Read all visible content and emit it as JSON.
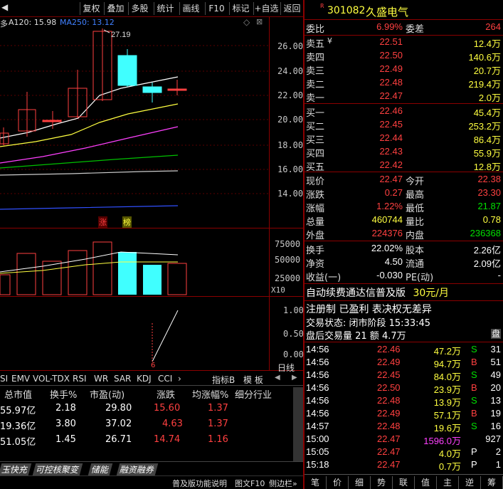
{
  "toolbar": {
    "back_arrow": "◀",
    "buttons": [
      "复权",
      "叠加",
      "多股",
      "统计",
      "画线",
      "F10",
      "标记",
      "+自选",
      "返回"
    ]
  },
  "chart_header": {
    "left_text": "多",
    "ma_text": "A120: 15.98",
    "ma250_text": "MA250: 13.12",
    "high_marker": "27.19"
  },
  "price_axis": [
    "26.00",
    "24.00",
    "22.00",
    "20.00",
    "18.00",
    "16.00",
    "14.00"
  ],
  "badges": {
    "zhang": "涨",
    "bang": "榜"
  },
  "volume_axis": [
    "75000",
    "50000",
    "25000",
    "X10"
  ],
  "indicator_axis": [
    "1.00",
    "0.50",
    "0.00"
  ],
  "indicator_date": "6",
  "sidebar_label": "日线",
  "indicator_tabs": [
    "SI",
    "EMV",
    "VOL-TDX",
    "RSI",
    "WR",
    "SAR",
    "KDJ",
    "CCI",
    "›"
  ],
  "indicator_extra": [
    "指标B",
    "模 板",
    "◀",
    "▶"
  ],
  "table": {
    "headers": [
      "总市值",
      "换手%",
      "市盈(动)",
      "涨跌",
      "均涨幅%",
      "细分行业"
    ],
    "rows": [
      [
        "55.97亿",
        "2.18",
        "29.80",
        "15.60",
        "1.37"
      ],
      [
        "19.36亿",
        "3.80",
        "37.02",
        "4.63",
        "1.37"
      ],
      [
        "51.05亿",
        "1.45",
        "26.71",
        "14.74",
        "1.16"
      ]
    ]
  },
  "bottom_tabs": [
    "玉快充",
    "可控核聚变",
    "储能",
    "融资融券"
  ],
  "bottom_right": [
    "普及版功能说明",
    "图文F10",
    "侧边栏»"
  ],
  "stock": {
    "code": "301082",
    "name": "久盛电气",
    "flag": "R"
  },
  "weibi": {
    "label1": "委比",
    "val1": "6.99%",
    "label2": "委差",
    "val2": "264"
  },
  "sells": [
    {
      "label": "卖五",
      "mark": "¥",
      "price": "22.51",
      "vol": "12.4万"
    },
    {
      "label": "卖四",
      "mark": "",
      "price": "22.50",
      "vol": "140.6万"
    },
    {
      "label": "卖三",
      "mark": "",
      "price": "22.49",
      "vol": "20.7万"
    },
    {
      "label": "卖二",
      "mark": "",
      "price": "22.48",
      "vol": "219.4万"
    },
    {
      "label": "卖一",
      "mark": "",
      "price": "22.47",
      "vol": "2.0万"
    }
  ],
  "buys": [
    {
      "label": "买一",
      "price": "22.46",
      "vol": "45.4万"
    },
    {
      "label": "买二",
      "price": "22.45",
      "vol": "253.2万"
    },
    {
      "label": "买三",
      "price": "22.44",
      "vol": "86.4万"
    },
    {
      "label": "买四",
      "price": "22.43",
      "vol": "55.9万"
    },
    {
      "label": "买五",
      "price": "22.42",
      "vol": "12.8万"
    }
  ],
  "stats1": [
    {
      "l1": "现价",
      "v1": "22.47",
      "l2": "今开",
      "v2": "22.38"
    },
    {
      "l1": "涨跌",
      "v1": "0.27",
      "l2": "最高",
      "v2": "23.30"
    },
    {
      "l1": "涨幅",
      "v1": "1.22%",
      "l2": "最低",
      "v2": "21.87"
    },
    {
      "l1": "总量",
      "v1": "460744",
      "l2": "量比",
      "v2": "0.78"
    },
    {
      "l1": "外盘",
      "v1": "224376",
      "l2": "内盘",
      "v2": "236368"
    }
  ],
  "stats2": [
    {
      "l1": "换手",
      "v1": "22.02%",
      "l2": "股本",
      "v2": "2.26亿"
    },
    {
      "l1": "净资",
      "v1": "4.50",
      "l2": "流通",
      "v2": "2.09亿"
    },
    {
      "l1": "收益(一)",
      "v1": "-0.030",
      "l2": "PE(动)",
      "v2": "-"
    }
  ],
  "promo": {
    "text": "自动续费通达信普及版",
    "price": "30元/月"
  },
  "tags": "注册制 已盈利 表决权无差异",
  "trade_status": "交易状态: 闭市阶段 15:33:45",
  "after_hours": "盘后交易量 21 额 4.7万",
  "ticks": [
    {
      "t": "14:56",
      "p": "22.46",
      "v": "47.2万",
      "s": "S",
      "n": "31"
    },
    {
      "t": "14:56",
      "p": "22.49",
      "v": "94.7万",
      "s": "B",
      "n": "51"
    },
    {
      "t": "14:56",
      "p": "22.45",
      "v": "84.0万",
      "s": "S",
      "n": "49"
    },
    {
      "t": "14:56",
      "p": "22.50",
      "v": "23.9万",
      "s": "B",
      "n": "20"
    },
    {
      "t": "14:56",
      "p": "22.48",
      "v": "13.9万",
      "s": "S",
      "n": "13"
    },
    {
      "t": "14:56",
      "p": "22.49",
      "v": "57.1万",
      "s": "B",
      "n": "19"
    },
    {
      "t": "14:57",
      "p": "22.48",
      "v": "19.6万",
      "s": "S",
      "n": "16"
    },
    {
      "t": "15:00",
      "p": "22.47",
      "v": "1596.0万",
      "s": "",
      "n": "927"
    },
    {
      "t": "15:05",
      "p": "22.47",
      "v": "4.0万",
      "s": "P",
      "n": "2"
    },
    {
      "t": "15:18",
      "p": "22.47",
      "v": "0.7万",
      "s": "P",
      "n": "1"
    }
  ],
  "side_tabs": [
    "笔",
    "价",
    "细",
    "势",
    "联",
    "值",
    "主",
    "逆",
    "筹"
  ],
  "colors": {
    "up": "#ff4040",
    "down": "#00e000",
    "cyan": "#40ffff",
    "grid": "#8b0000"
  }
}
